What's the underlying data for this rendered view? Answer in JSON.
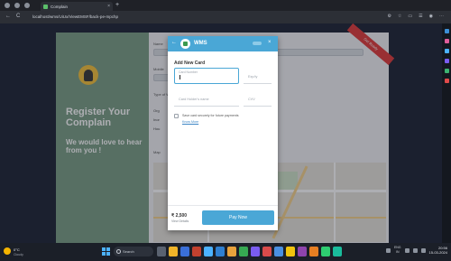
{
  "browser": {
    "tab_title": "Complain",
    "url": "localhost/wms/UiUx/ViewEMSF/back-pe-mpchp",
    "back_icon": "←",
    "reload_icon": "C",
    "new_tab_icon": "+",
    "close_tab_icon": "×"
  },
  "page": {
    "heading": "Register Your Complain",
    "subheading": "We would love to hear from you !",
    "ribbon_text": "Get Ready",
    "labels": [
      "Name",
      "Mobile",
      "Type of Waste",
      "Map"
    ],
    "radio_options": [
      "Org",
      "Inor",
      "Hou"
    ]
  },
  "modal": {
    "brand": "WMS",
    "back_icon": "←",
    "close_icon": "×",
    "title": "Add New Card",
    "card_number_label": "Card Number",
    "expiry_placeholder": "Exp/iy",
    "holder_placeholder": "Card Holder's name",
    "cvv_placeholder": "CVV",
    "save_text": "Save card securely for future payments",
    "know_more": "Know More",
    "amount": "₹ 2,500",
    "view_details": "View Details",
    "pay_label": "Pay Now"
  },
  "taskbar": {
    "weather_temp": "0°C",
    "weather_desc": "Cloudy",
    "search_placeholder": "Search",
    "lang": "ENG",
    "lang_sub": "IN",
    "time": "20:56",
    "date": "15-03-2024"
  },
  "colors": {
    "accent": "#4aa7d6",
    "panel": "#7b9e86",
    "ribbon": "#e03c3c"
  }
}
